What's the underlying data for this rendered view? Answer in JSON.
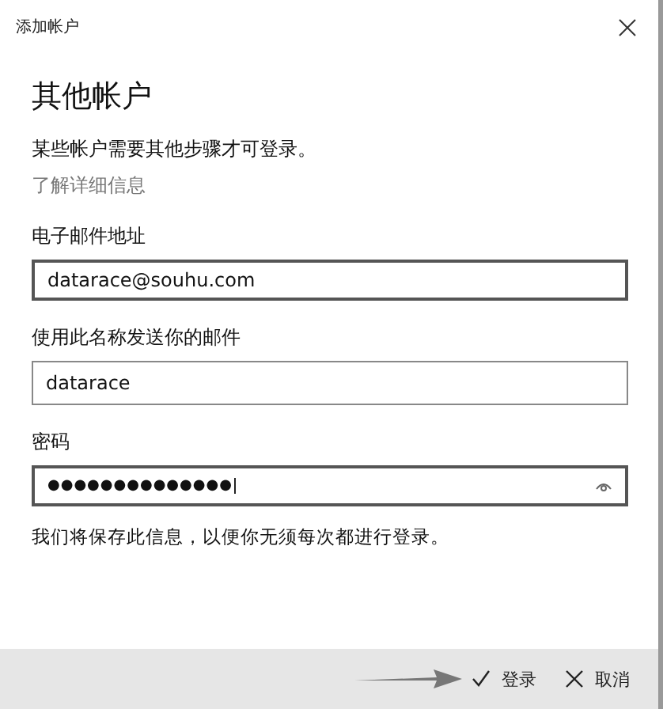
{
  "window": {
    "title": "添加帐户"
  },
  "heading": "其他帐户",
  "description": "某些帐户需要其他步骤才可登录。",
  "link": "了解详细信息",
  "fields": [
    {
      "kind": "text",
      "label": "电子邮件地址",
      "value": "datarace@souhu.com"
    },
    {
      "kind": "text",
      "label": "使用此名称发送你的邮件",
      "value": "datarace"
    },
    {
      "kind": "password",
      "label": "密码",
      "value": "●●●●●●●●●●●●●●"
    }
  ],
  "note": "我们将保存此信息，以便你无须每次都进行登录。",
  "buttons": [
    {
      "kind": "confirm",
      "label": "登录"
    },
    {
      "kind": "cancel",
      "label": "取消"
    }
  ]
}
